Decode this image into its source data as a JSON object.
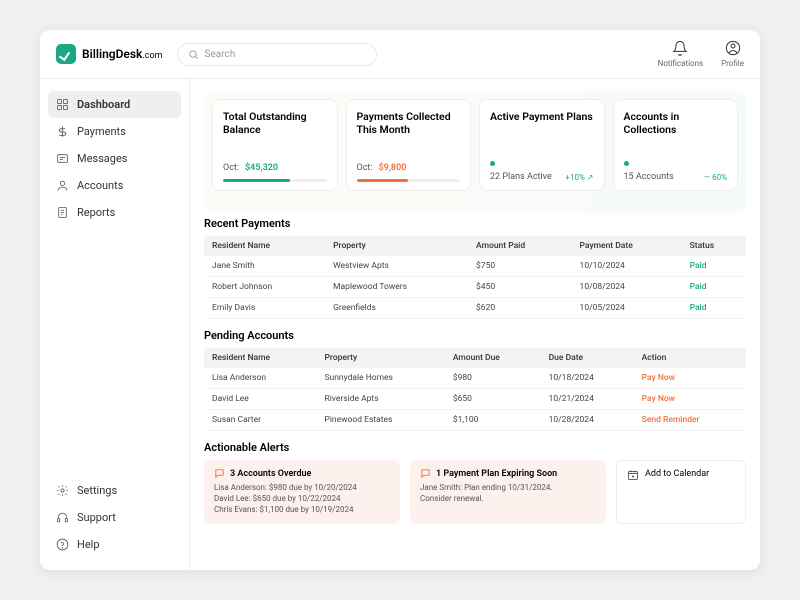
{
  "brand": {
    "name": "BillingDesk",
    "suffix": ".com"
  },
  "search": {
    "placeholder": "Search"
  },
  "topbar": {
    "notifications": "Notifications",
    "profile": "Profile"
  },
  "nav": {
    "main": [
      {
        "key": "dashboard",
        "label": "Dashboard",
        "active": true
      },
      {
        "key": "payments",
        "label": "Payments"
      },
      {
        "key": "messages",
        "label": "Messages"
      },
      {
        "key": "accounts",
        "label": "Accounts"
      },
      {
        "key": "reports",
        "label": "Reports"
      }
    ],
    "bottom": [
      {
        "key": "settings",
        "label": "Settings"
      },
      {
        "key": "support",
        "label": "Support"
      },
      {
        "key": "help",
        "label": "Help"
      }
    ]
  },
  "cards": {
    "outstanding": {
      "title": "Total Outstanding Balance",
      "period": "Oct:",
      "value": "$45,320",
      "pct": 65,
      "color": "#1ba784"
    },
    "collected": {
      "title": "Payments Collected This Month",
      "period": "Oct:",
      "value": "$9,800",
      "pct": 50,
      "color": "#f0703a"
    },
    "plans": {
      "title": "Active Payment Plans",
      "sub": "22 Plans Active",
      "delta": "+10% ↗"
    },
    "collections": {
      "title": "Accounts in Collections",
      "sub": "15 Accounts",
      "delta": "— 60%"
    }
  },
  "recent": {
    "title": "Recent Payments",
    "cols": [
      "Resident Name",
      "Property",
      "Amount Paid",
      "Payment Date",
      "Status"
    ],
    "rows": [
      {
        "name": "Jane Smith",
        "prop": "Westview Apts",
        "amt": "$750",
        "date": "10/10/2024",
        "status": "Paid"
      },
      {
        "name": "Robert Johnson",
        "prop": "Maplewood Towers",
        "amt": "$450",
        "date": "10/08/2024",
        "status": "Paid"
      },
      {
        "name": "Emily Davis",
        "prop": "Greenfields",
        "amt": "$620",
        "date": "10/05/2024",
        "status": "Paid"
      }
    ]
  },
  "pending": {
    "title": "Pending Accounts",
    "cols": [
      "Resident Name",
      "Property",
      "Amount Due",
      "Due Date",
      "Action"
    ],
    "rows": [
      {
        "name": "Lisa Anderson",
        "prop": "Sunnydale Homes",
        "amt": "$980",
        "date": "10/18/2024",
        "action": "Pay Now"
      },
      {
        "name": "David Lee",
        "prop": "Riverside Apts",
        "amt": "$650",
        "date": "10/21/2024",
        "action": "Pay Now"
      },
      {
        "name": "Susan Carter",
        "prop": "Pinewood Estates",
        "amt": "$1,100",
        "date": "10/28/2024",
        "action": "Send Reminder"
      }
    ]
  },
  "alerts": {
    "title": "Actionable Alerts",
    "overdue": {
      "title": "3 Accounts Overdue",
      "lines": [
        "Lisa Anderson: $980 due by 10/20/2024",
        "David Lee: $650 due by 10/22/2024",
        "Chris Evans: $1,100 due by 10/19/2024"
      ]
    },
    "expiring": {
      "title": "1 Payment Plan Expiring Soon",
      "lines": [
        "Jane Smith: Plan ending 10/31/2024.",
        "Consider renewal."
      ]
    },
    "calendar": "Add to Calendar"
  }
}
